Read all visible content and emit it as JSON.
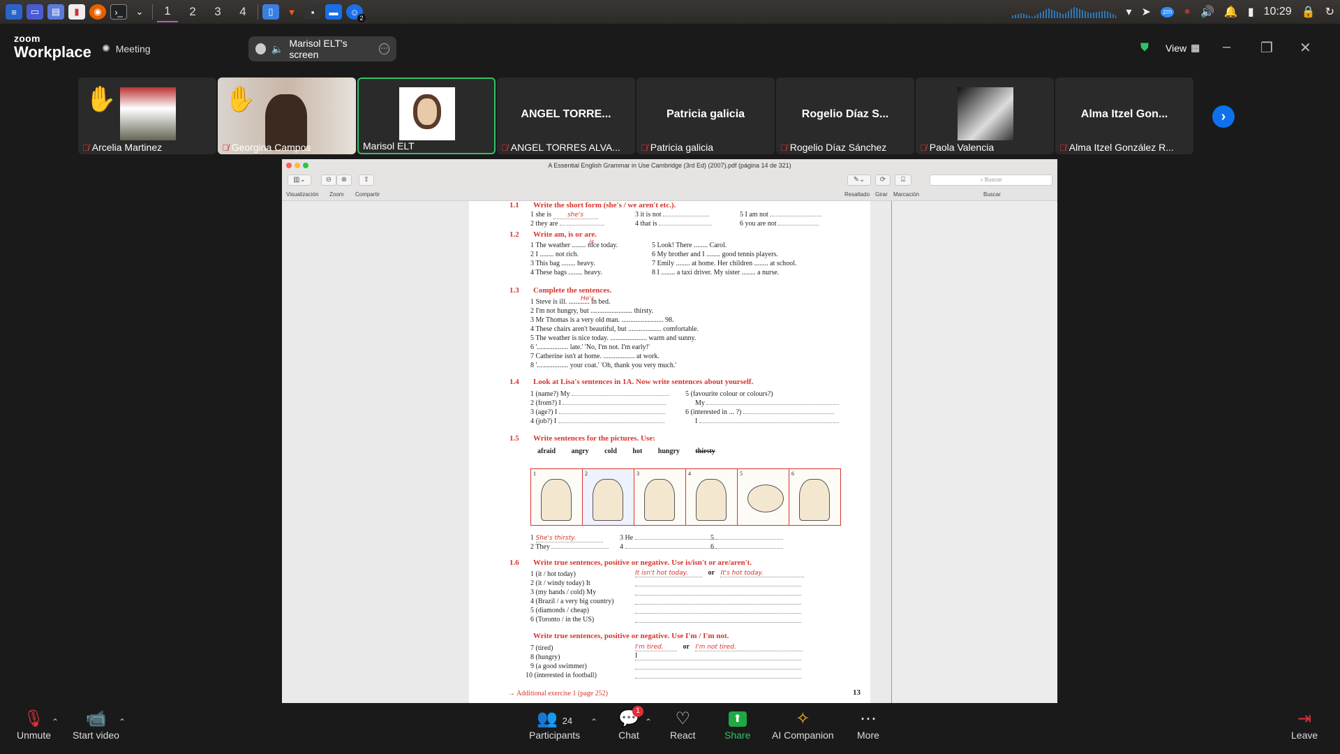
{
  "taskbar": {
    "workspaces": [
      "1",
      "2",
      "3",
      "4"
    ],
    "active_workspace": "1",
    "clock": "10:29",
    "notif_badge": "2",
    "accent": "#b35cc9"
  },
  "header": {
    "logo_small": "zoom",
    "logo_big": "Workplace",
    "meeting_label": "Meeting",
    "screen_label": "Marisol ELT's screen",
    "view_label": "View"
  },
  "participants": [
    {
      "name": "Arcelia Martinez",
      "hand": true,
      "video": true
    },
    {
      "name": "Georgina Campos",
      "hand": true,
      "video": true
    },
    {
      "name": "Marisol ELT",
      "hand": false,
      "video": true,
      "active": true
    },
    {
      "name": "ANGEL TORRES ALVA...",
      "big": "ANGEL TORRE...",
      "hand": false,
      "video": false
    },
    {
      "name": "Patricia galicia",
      "big": "Patricia galicia",
      "hand": false,
      "video": false
    },
    {
      "name": "Rogelio Díaz Sánchez",
      "big": "Rogelio Díaz S...",
      "hand": false,
      "video": false
    },
    {
      "name": "Paola Valencia",
      "hand": false,
      "video": true
    },
    {
      "name": "Alma Itzel González R...",
      "big": "Alma Itzel Gon...",
      "hand": false,
      "video": false
    }
  ],
  "preview": {
    "title": "A Essential English Grammar in Use Cambridge (3rd Ed) (2007).pdf (página 14 de 321)",
    "tools": [
      "Visualización",
      "Zoom",
      "Compartir",
      "Resaltado",
      "Girar",
      "Marcación",
      "Buscar"
    ],
    "search_placeholder": "Buscar"
  },
  "page": {
    "s11": {
      "n": "1.1",
      "title": "Write the short form (she's / we aren't etc.)."
    },
    "s11_rows": [
      "1  she is",
      "2  they are",
      "3  it is not",
      "4  that is",
      "5  I am not",
      "6  you are not"
    ],
    "s11_ans": "she's",
    "s12": {
      "n": "1.2",
      "title": "Write am, is or are."
    },
    "s12_rows": [
      "1  The weather ........ nice today.",
      "2  I ........ not rich.",
      "3  This bag ........ heavy.",
      "4  These bags ........ heavy.",
      "5  Look! There ........ Carol.",
      "6  My brother and I ........ good tennis players.",
      "7  Emily ........ at home.  Her children ........ at school.",
      "8  I ........ a taxi driver.  My sister ........ a nurse."
    ],
    "s12_ans": "is",
    "s13": {
      "n": "1.3",
      "title": "Complete the sentences."
    },
    "s13_rows": [
      "1  Steve is ill.  ............ in bed.",
      "2  I'm not hungry, but ........................ thirsty.",
      "3  Mr Thomas is a very old man.  ........................ 98.",
      "4  These chairs aren't beautiful, but ................... comfortable.",
      "5  The weather is nice today.  ..................... warm and sunny.",
      "6  '.................. late.'   'No, I'm not. I'm early!'",
      "7  Catherine isn't at home.  .................. at work.",
      "8  '.................. your coat.'   'Oh, thank you very much.'"
    ],
    "s13_ans": "He's",
    "s14": {
      "n": "1.4",
      "title": "Look at Lisa's sentences in 1A. Now write sentences about yourself."
    },
    "s14_left": [
      "1  (name?)  My",
      "2  (from?)  I",
      "3  (age?)  I",
      "4  (job?)  I"
    ],
    "s14_right": [
      "5  (favourite colour or colours?)",
      "My",
      "6  (interested in ... ?)",
      "I"
    ],
    "s15": {
      "n": "1.5",
      "title": "Write sentences for the pictures. Use:"
    },
    "s15_words": [
      "afraid",
      "angry",
      "cold",
      "hot",
      "hungry",
      "thirsty"
    ],
    "s15_pics": [
      "1",
      "2",
      "3",
      "4",
      "5",
      "6"
    ],
    "s15_rows": [
      "1",
      "2  They",
      "3  He",
      "4",
      "5",
      "6"
    ],
    "s15_ans": "She's thirsty.",
    "s16": {
      "n": "1.6",
      "title": "Write true sentences, positive or negative. Use is/isn't or are/aren't."
    },
    "s16_rows": [
      "1  (it / hot today)",
      "2  (it / windy today)  It",
      "3  (my hands / cold)  My",
      "4  (Brazil / a very big country)",
      "5  (diamonds / cheap)",
      "6  (Toronto / in the US)"
    ],
    "s16_ans1": "It isn't hot today.",
    "s16_ans2": "It's hot today.",
    "or": "or",
    "s16b_title": "Write true sentences, positive or negative. Use I'm / I'm not.",
    "s16b_rows": [
      "7  (tired)",
      "8  (hungry)",
      "9  (a good swimmer)",
      "10  (interested in football)"
    ],
    "s16b_ans1": "I'm tired.",
    "s16b_ans2": "I'm not tired.",
    "s16b_i": "I",
    "footer": "→ Additional exercise 1 (page 252)",
    "page_number": "13"
  },
  "controls": {
    "unmute": "Unmute",
    "start_video": "Start video",
    "participants": "Participants",
    "participants_count": "24",
    "chat": "Chat",
    "chat_badge": "1",
    "react": "React",
    "share": "Share",
    "ai": "AI Companion",
    "more": "More",
    "leave": "Leave"
  }
}
